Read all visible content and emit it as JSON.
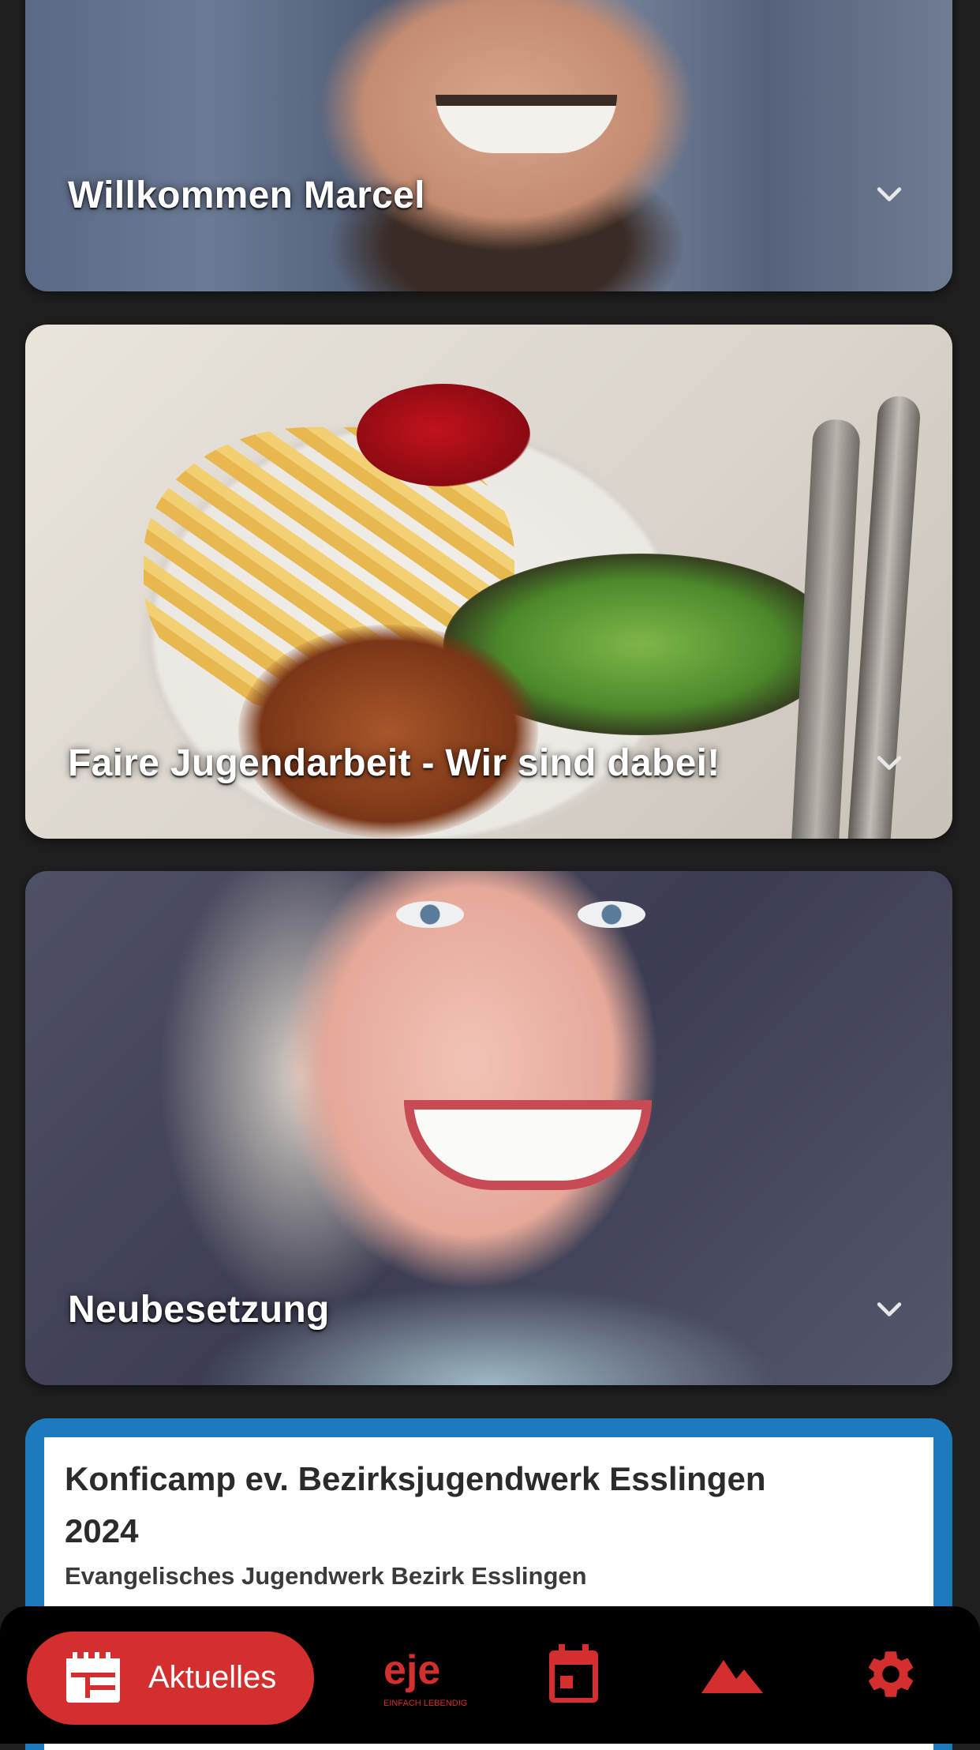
{
  "cards": [
    {
      "title": "Willkommen Marcel"
    },
    {
      "title": "Faire Jugendarbeit - Wir sind dabei!"
    },
    {
      "title": "Neubesetzung"
    }
  ],
  "event_card": {
    "title": "Konficamp ev. Bezirksjugendwerk Esslingen 2024",
    "organizer": "Evangelisches Jugendwerk Bezirk Esslingen",
    "accent_color": "#1d7bbd"
  },
  "bottom_nav": {
    "active_label": "Aktuelles",
    "logo_text": "EINFACH LEBENDIG",
    "logo_letters": "eje",
    "items": [
      "news-icon",
      "eje-logo",
      "calendar-icon",
      "mountain-icon",
      "gear-icon"
    ],
    "accent_color": "#d32f2f"
  }
}
